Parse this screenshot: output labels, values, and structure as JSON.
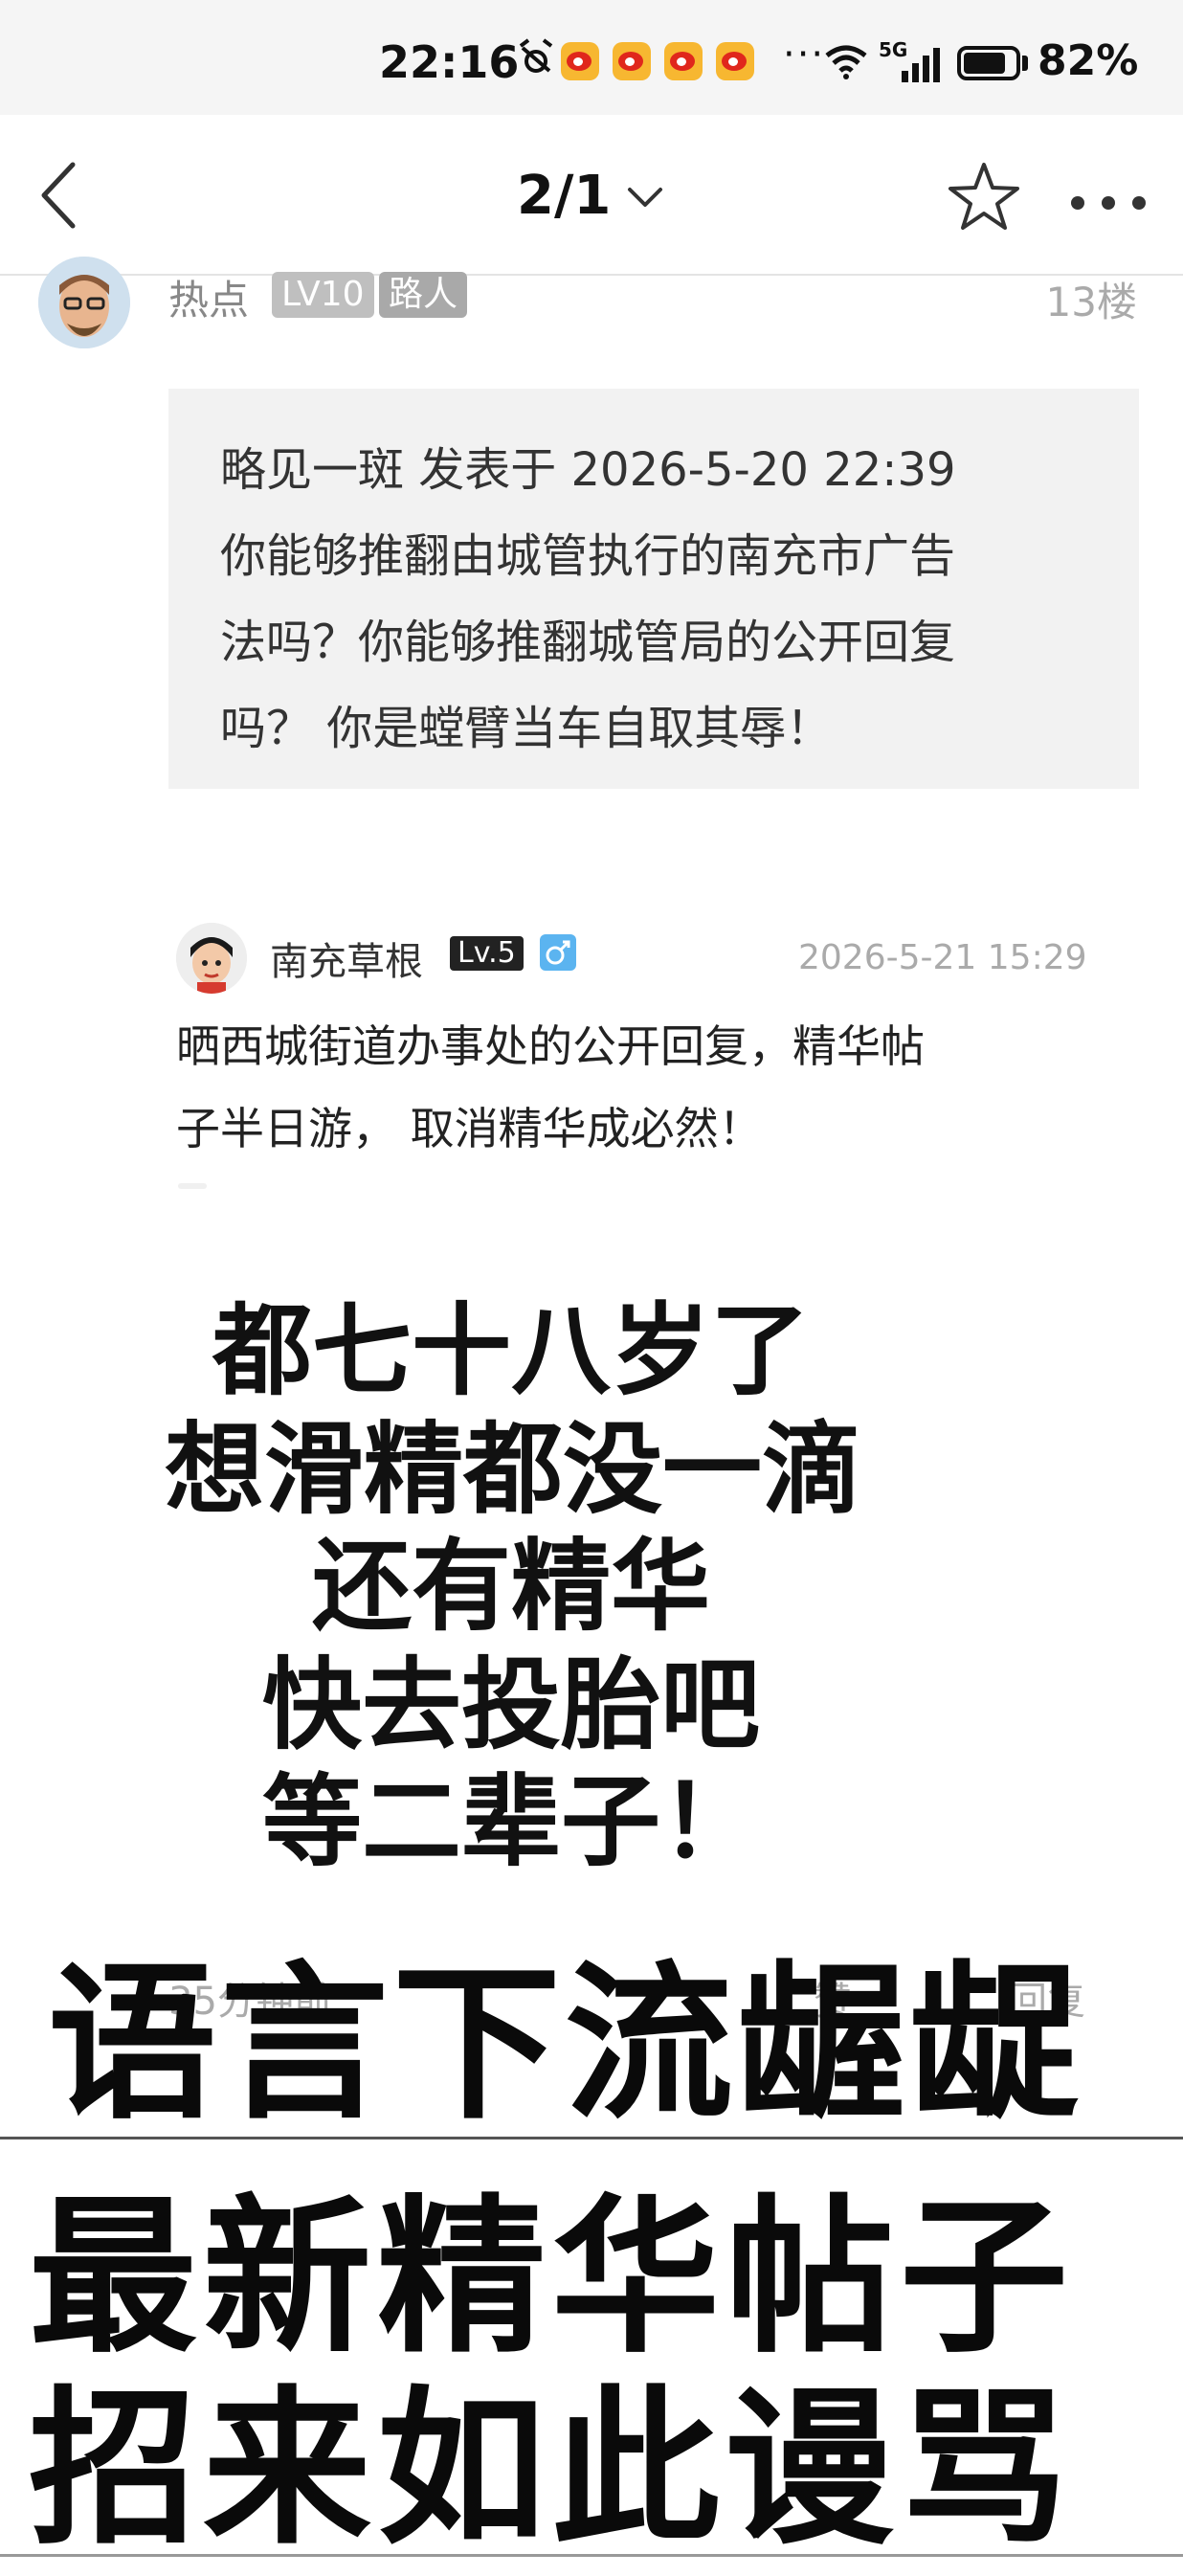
{
  "status_bar": {
    "time": "22:16",
    "alarm_icon": "alarm-off-icon",
    "notification_icons": [
      "weibo-icon",
      "weibo-icon",
      "weibo-icon",
      "weibo-icon"
    ],
    "more": "···",
    "network": "5G",
    "battery_percent": "82%",
    "battery_level": 0.82
  },
  "nav": {
    "back_icon": "back-icon",
    "title": "2/1",
    "dropdown_icon": "chevron-down-icon",
    "favorite_icon": "star-icon",
    "more_icon": "more-icon"
  },
  "post": {
    "user": {
      "name": "热点",
      "level": "LV10",
      "role": "路人"
    },
    "floor": "13楼",
    "quote": {
      "lines": [
        "略见一斑 发表于 2026-5-20 22:39",
        "你能够推翻由城管执行的南充市广告",
        "法吗？你能够推翻城管局的公开回复",
        "吗？  你是螳臂当车自取其辱！"
      ]
    },
    "reply": {
      "user": "南充草根",
      "level": "Lv.5",
      "gender_icon": "male-icon",
      "time": "2026-5-21 15:29",
      "lines": [
        "晒西城街道办事处的公开回复，精华帖",
        "子半日游， 取消精华成必然！"
      ]
    },
    "footer": {
      "time": "35分钟前",
      "like": "赞",
      "reply": "回复"
    }
  },
  "overlay": {
    "lines": [
      "都七十八岁了",
      "想滑精都没一滴",
      "还有精华",
      "快去投胎吧",
      "等二辈子！"
    ],
    "caption1": "语言下流龌龊",
    "caption2": [
      "最新精华帖子",
      "招来如此谩骂"
    ]
  },
  "colors": {
    "status_bg": "#f5f5f5",
    "quote_bg": "#f2f2f2",
    "weibo": "#e0271c",
    "male": "#5bb4f0"
  }
}
